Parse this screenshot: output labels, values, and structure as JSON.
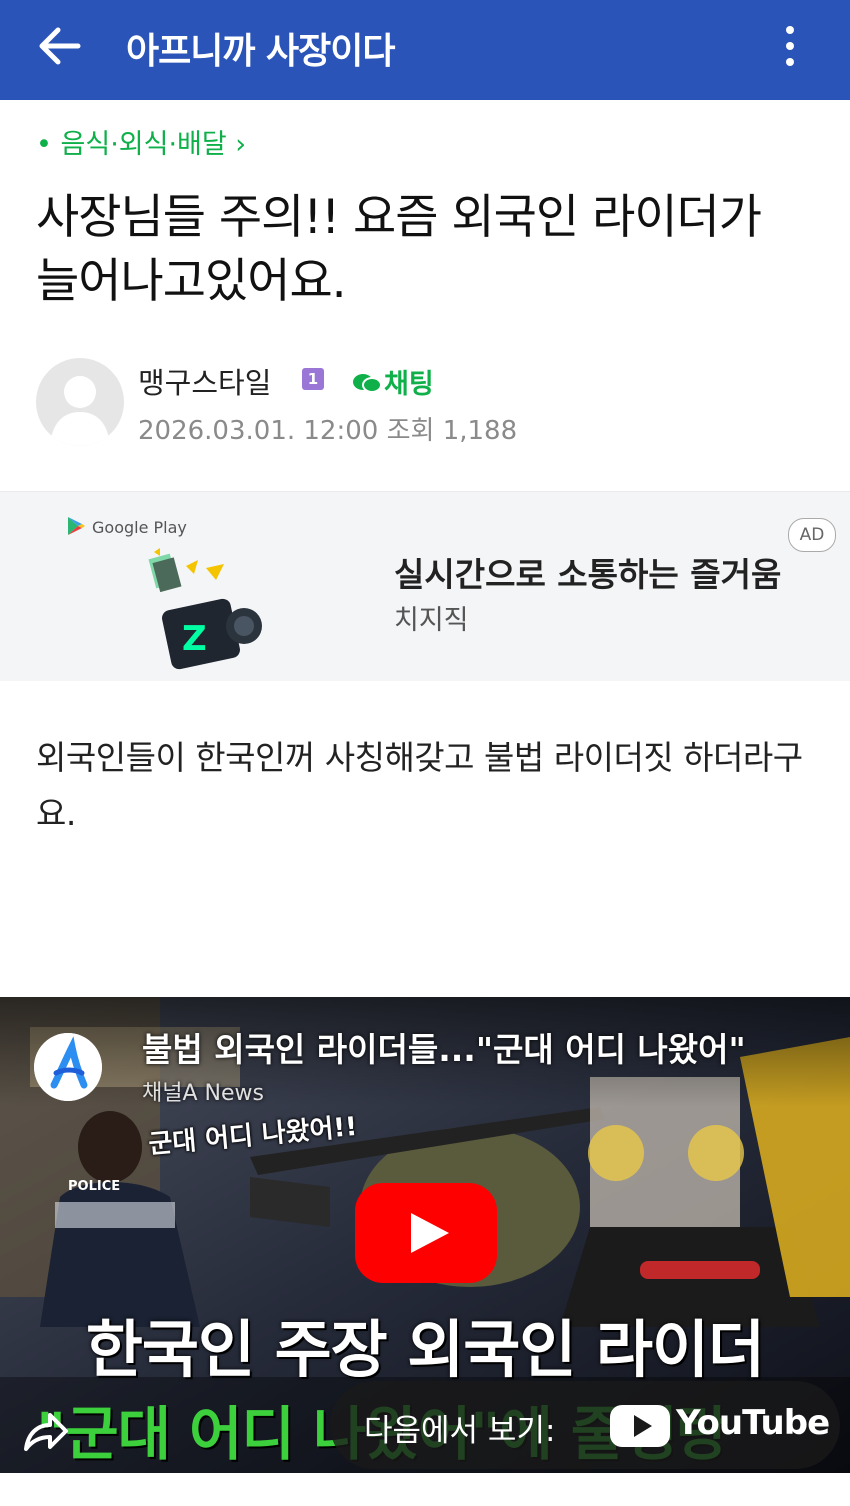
{
  "topbar": {
    "title": "아프니까 사장이다",
    "back_icon": "arrow-left-icon",
    "more_icon": "kebab-icon",
    "bg": "#2a54b8"
  },
  "post": {
    "category": "• 음식·외식·배달 ›",
    "title": "사장님들 주의!! 요즘 외국인 라이더가 늘어나고있어요.",
    "author": "맹구스타일",
    "badge": "1",
    "chat_label": "채팅",
    "meta": "2026.03.01. 12:00  조회 1,188",
    "body": "외국인들이 한국인꺼 사칭해갖고 불법 라이더짓 하더라구요."
  },
  "ad": {
    "store": "Google Play",
    "badge": "AD",
    "title": "실시간으로 소통하는 즐거움",
    "subtitle": "치지직"
  },
  "video": {
    "title": "불법 외국인 라이더들...\"군대 어디 나왔어\"",
    "channel": "채널A News",
    "caption_small": "군대 어디 나왔어!!",
    "police": "POLICE",
    "caption_big": "한국인 주장 외국인 라이더",
    "caption_green": "\"군대 어디 나왔어\"에 줄행랑",
    "watch_label": "다음에서 보기:",
    "yt_word": "YouTube"
  },
  "colors": {
    "accent_green": "#0fb04a",
    "youtube_red": "#ff0000"
  }
}
